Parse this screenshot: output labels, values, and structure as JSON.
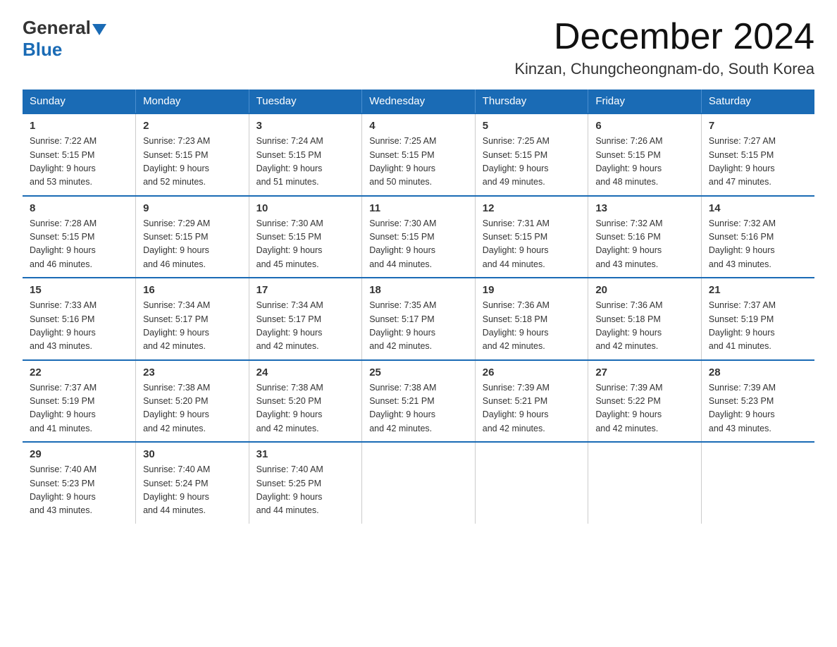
{
  "header": {
    "logo_general": "General",
    "logo_blue": "Blue",
    "month": "December 2024",
    "location": "Kinzan, Chungcheongnam-do, South Korea"
  },
  "weekdays": [
    "Sunday",
    "Monday",
    "Tuesday",
    "Wednesday",
    "Thursday",
    "Friday",
    "Saturday"
  ],
  "weeks": [
    [
      {
        "day": "1",
        "sunrise": "7:22 AM",
        "sunset": "5:15 PM",
        "daylight": "9 hours and 53 minutes."
      },
      {
        "day": "2",
        "sunrise": "7:23 AM",
        "sunset": "5:15 PM",
        "daylight": "9 hours and 52 minutes."
      },
      {
        "day": "3",
        "sunrise": "7:24 AM",
        "sunset": "5:15 PM",
        "daylight": "9 hours and 51 minutes."
      },
      {
        "day": "4",
        "sunrise": "7:25 AM",
        "sunset": "5:15 PM",
        "daylight": "9 hours and 50 minutes."
      },
      {
        "day": "5",
        "sunrise": "7:25 AM",
        "sunset": "5:15 PM",
        "daylight": "9 hours and 49 minutes."
      },
      {
        "day": "6",
        "sunrise": "7:26 AM",
        "sunset": "5:15 PM",
        "daylight": "9 hours and 48 minutes."
      },
      {
        "day": "7",
        "sunrise": "7:27 AM",
        "sunset": "5:15 PM",
        "daylight": "9 hours and 47 minutes."
      }
    ],
    [
      {
        "day": "8",
        "sunrise": "7:28 AM",
        "sunset": "5:15 PM",
        "daylight": "9 hours and 46 minutes."
      },
      {
        "day": "9",
        "sunrise": "7:29 AM",
        "sunset": "5:15 PM",
        "daylight": "9 hours and 46 minutes."
      },
      {
        "day": "10",
        "sunrise": "7:30 AM",
        "sunset": "5:15 PM",
        "daylight": "9 hours and 45 minutes."
      },
      {
        "day": "11",
        "sunrise": "7:30 AM",
        "sunset": "5:15 PM",
        "daylight": "9 hours and 44 minutes."
      },
      {
        "day": "12",
        "sunrise": "7:31 AM",
        "sunset": "5:15 PM",
        "daylight": "9 hours and 44 minutes."
      },
      {
        "day": "13",
        "sunrise": "7:32 AM",
        "sunset": "5:16 PM",
        "daylight": "9 hours and 43 minutes."
      },
      {
        "day": "14",
        "sunrise": "7:32 AM",
        "sunset": "5:16 PM",
        "daylight": "9 hours and 43 minutes."
      }
    ],
    [
      {
        "day": "15",
        "sunrise": "7:33 AM",
        "sunset": "5:16 PM",
        "daylight": "9 hours and 43 minutes."
      },
      {
        "day": "16",
        "sunrise": "7:34 AM",
        "sunset": "5:17 PM",
        "daylight": "9 hours and 42 minutes."
      },
      {
        "day": "17",
        "sunrise": "7:34 AM",
        "sunset": "5:17 PM",
        "daylight": "9 hours and 42 minutes."
      },
      {
        "day": "18",
        "sunrise": "7:35 AM",
        "sunset": "5:17 PM",
        "daylight": "9 hours and 42 minutes."
      },
      {
        "day": "19",
        "sunrise": "7:36 AM",
        "sunset": "5:18 PM",
        "daylight": "9 hours and 42 minutes."
      },
      {
        "day": "20",
        "sunrise": "7:36 AM",
        "sunset": "5:18 PM",
        "daylight": "9 hours and 42 minutes."
      },
      {
        "day": "21",
        "sunrise": "7:37 AM",
        "sunset": "5:19 PM",
        "daylight": "9 hours and 41 minutes."
      }
    ],
    [
      {
        "day": "22",
        "sunrise": "7:37 AM",
        "sunset": "5:19 PM",
        "daylight": "9 hours and 41 minutes."
      },
      {
        "day": "23",
        "sunrise": "7:38 AM",
        "sunset": "5:20 PM",
        "daylight": "9 hours and 42 minutes."
      },
      {
        "day": "24",
        "sunrise": "7:38 AM",
        "sunset": "5:20 PM",
        "daylight": "9 hours and 42 minutes."
      },
      {
        "day": "25",
        "sunrise": "7:38 AM",
        "sunset": "5:21 PM",
        "daylight": "9 hours and 42 minutes."
      },
      {
        "day": "26",
        "sunrise": "7:39 AM",
        "sunset": "5:21 PM",
        "daylight": "9 hours and 42 minutes."
      },
      {
        "day": "27",
        "sunrise": "7:39 AM",
        "sunset": "5:22 PM",
        "daylight": "9 hours and 42 minutes."
      },
      {
        "day": "28",
        "sunrise": "7:39 AM",
        "sunset": "5:23 PM",
        "daylight": "9 hours and 43 minutes."
      }
    ],
    [
      {
        "day": "29",
        "sunrise": "7:40 AM",
        "sunset": "5:23 PM",
        "daylight": "9 hours and 43 minutes."
      },
      {
        "day": "30",
        "sunrise": "7:40 AM",
        "sunset": "5:24 PM",
        "daylight": "9 hours and 44 minutes."
      },
      {
        "day": "31",
        "sunrise": "7:40 AM",
        "sunset": "5:25 PM",
        "daylight": "9 hours and 44 minutes."
      },
      null,
      null,
      null,
      null
    ]
  ]
}
